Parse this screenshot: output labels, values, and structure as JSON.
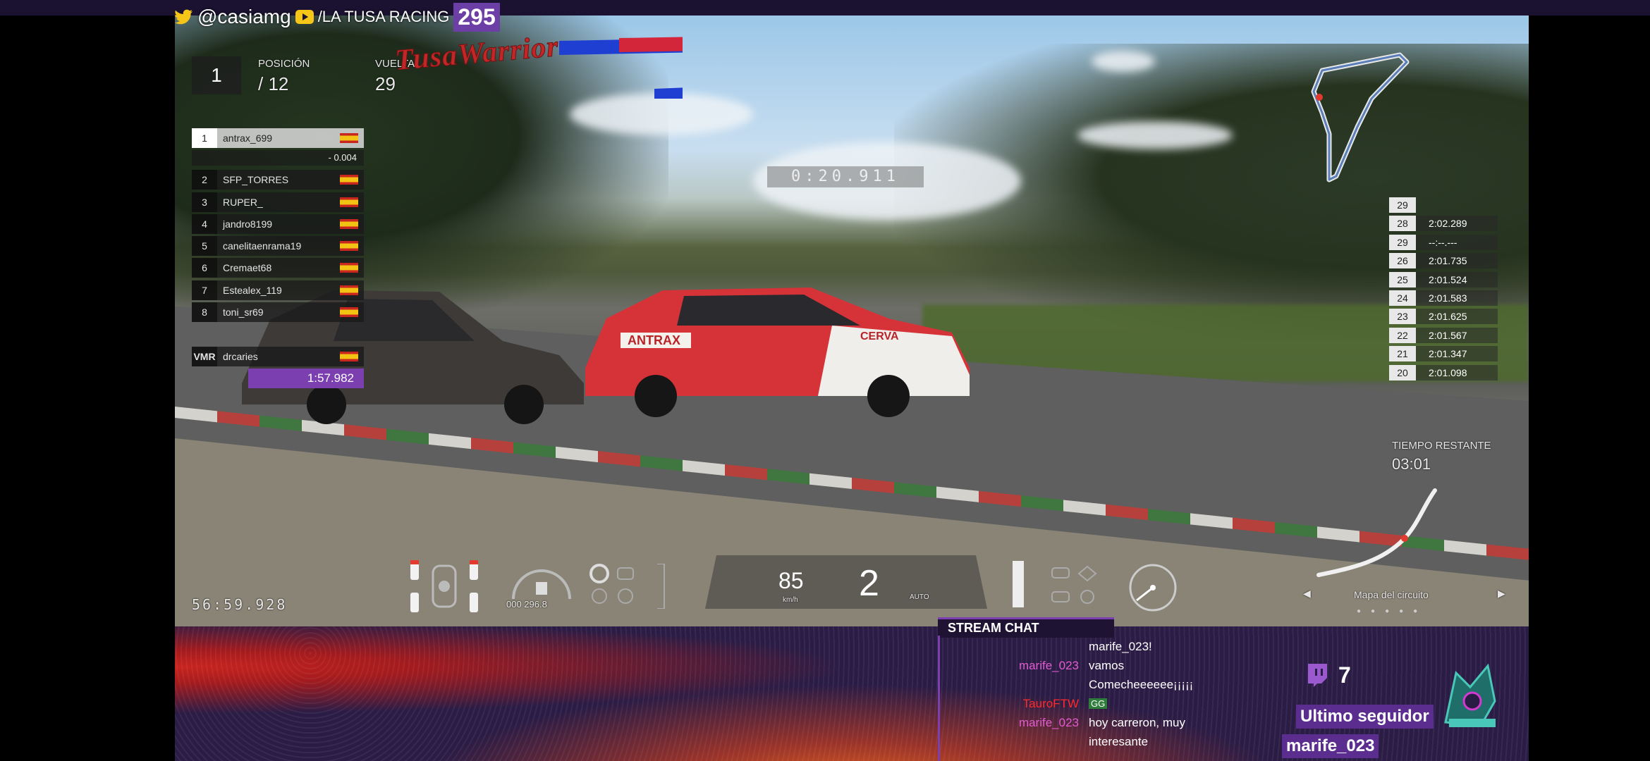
{
  "stream": {
    "twitter_handle": "@casiamg",
    "channel_name": "/LA TUSA RACING",
    "viewer_count": "295"
  },
  "hud": {
    "position_label": "POSICIÓN",
    "position_current": "1",
    "position_total": "/ 12",
    "lap_label": "VUELTA",
    "lap_value": "29",
    "leader_gap": "- 0.004",
    "lap_timer": "0:20.911",
    "standings": [
      {
        "pos": "1",
        "name": "antrax_699"
      },
      {
        "pos": "2",
        "name": "SFP_TORRES"
      },
      {
        "pos": "3",
        "name": "RUPER_"
      },
      {
        "pos": "4",
        "name": "jandro8199"
      },
      {
        "pos": "5",
        "name": "canelitaenrama19"
      },
      {
        "pos": "6",
        "name": "Cremaet68"
      },
      {
        "pos": "7",
        "name": "Estealex_119"
      },
      {
        "pos": "8",
        "name": "toni_sr69"
      }
    ],
    "vmr": {
      "label": "VMR",
      "name": "drcaries",
      "time": "1:57.982"
    },
    "lap_times": [
      {
        "lap": "29",
        "time": ""
      },
      {
        "lap": "28",
        "time": "2:02.289"
      },
      {
        "lap": "29",
        "time": "--:--.---"
      },
      {
        "lap": "26",
        "time": "2:01.735"
      },
      {
        "lap": "25",
        "time": "2:01.524"
      },
      {
        "lap": "24",
        "time": "2:01.583"
      },
      {
        "lap": "23",
        "time": "2:01.625"
      },
      {
        "lap": "22",
        "time": "2:01.567"
      },
      {
        "lap": "21",
        "time": "2:01.347"
      },
      {
        "lap": "20",
        "time": "2:01.098"
      }
    ],
    "remaining_label": "TIEMPO RESTANTE",
    "remaining_value": "03:01",
    "circuit_label": "Mapa del circuito",
    "total_time": "56:59.928",
    "fuel_readout": "000 296.8",
    "speed": "85",
    "speed_unit": "km/h",
    "gear": "2",
    "gear_mode": "AUTO"
  },
  "overlay": {
    "brand": "TusaWarrior",
    "chat_title": "STREAM CHAT",
    "chat": [
      {
        "user": "",
        "text": "marife_023!",
        "color": "#ffffff"
      },
      {
        "user": "marife_023",
        "text": "vamos",
        "color": "#e35bd0"
      },
      {
        "user": "",
        "text": "Comecheeeeee¡¡¡¡¡",
        "color": "#ffffff"
      },
      {
        "user": "TauroFTW",
        "text": "GG",
        "color": "#ff2a2a"
      },
      {
        "user": "marife_023",
        "text": "hoy carreron, muy",
        "color": "#e35bd0"
      },
      {
        "user": "",
        "text": "interesante",
        "color": "#ffffff"
      }
    ],
    "follower_count": "7",
    "last_follower_label": "Ultimo seguidor",
    "last_follower_name": "marife_023"
  },
  "colors": {
    "accent_purple": "#7b3fb0",
    "brand_red": "#c32626"
  }
}
